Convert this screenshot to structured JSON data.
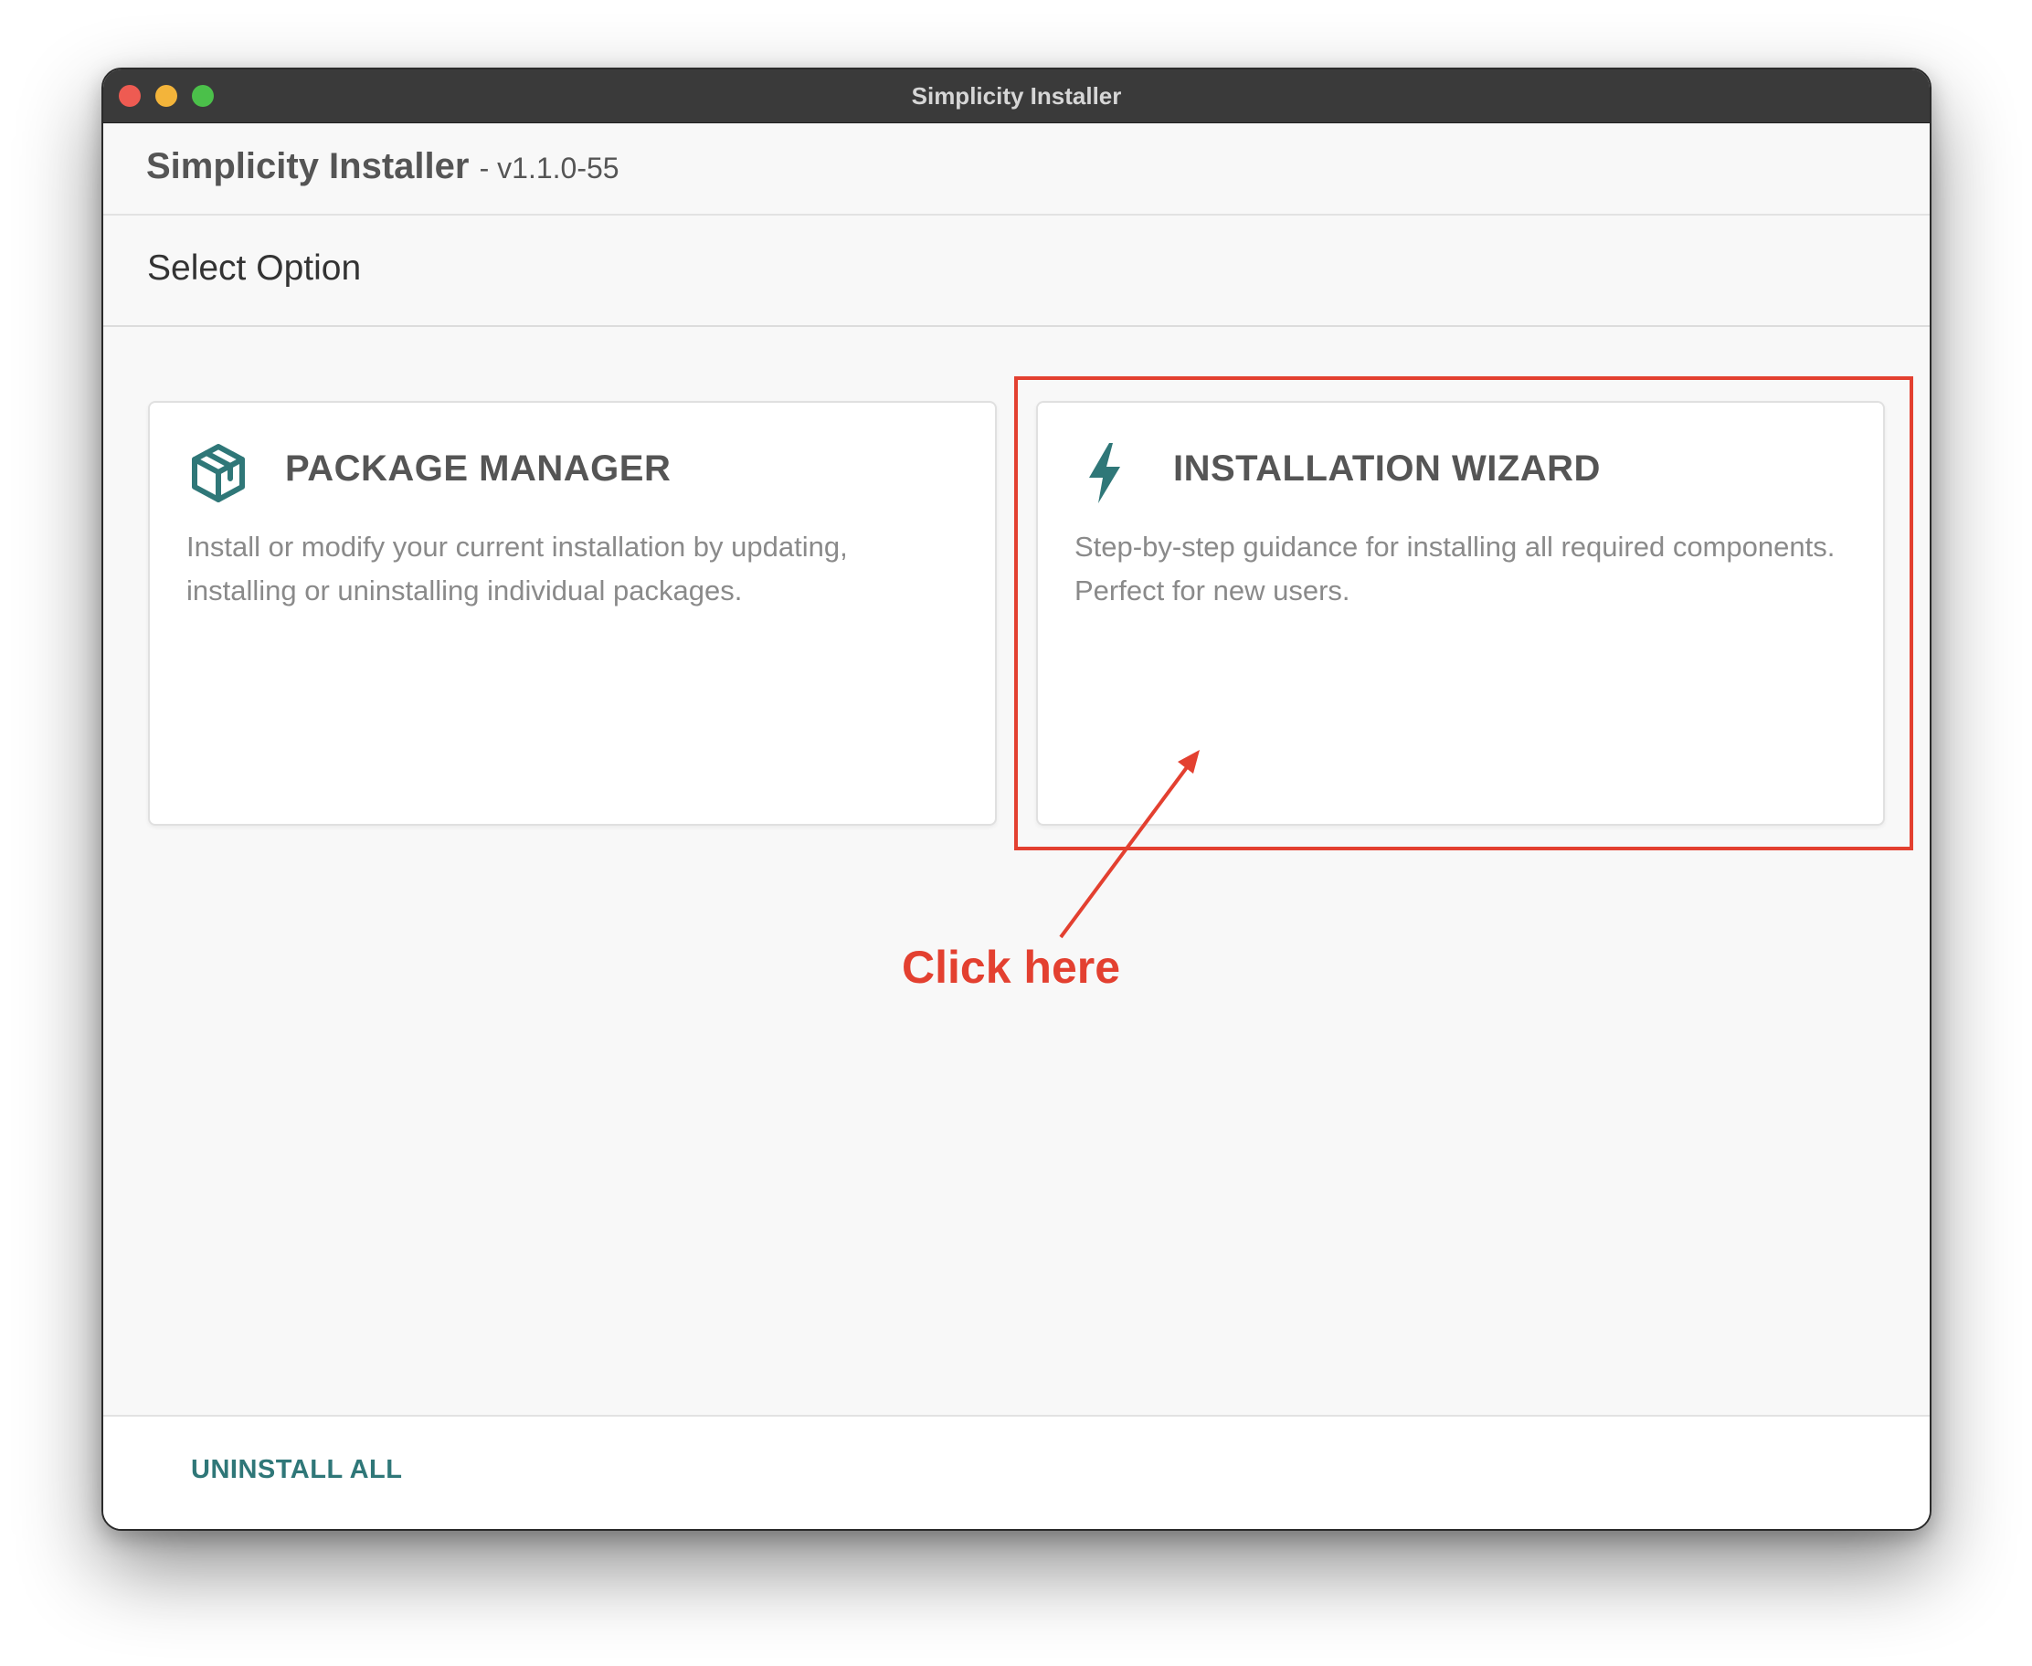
{
  "window": {
    "title": "Simplicity Installer"
  },
  "header": {
    "app_name": "Simplicity Installer",
    "version": "- v1.1.0-55"
  },
  "section": {
    "title": "Select Option"
  },
  "options": [
    {
      "title": "PACKAGE MANAGER",
      "description": "Install or modify your current installation by updating, installing or uninstalling individual packages.",
      "icon": "package-box-icon"
    },
    {
      "title": "INSTALLATION WIZARD",
      "description": "Step-by-step guidance for installing all required components. Perfect for new users.",
      "icon": "lightning-bolt-icon"
    }
  ],
  "annotation": {
    "text": "Click here",
    "color": "#e34030"
  },
  "footer": {
    "uninstall_label": "UNINSTALL ALL"
  },
  "colors": {
    "accent": "#2f7778",
    "titlebar": "#3a3a3a",
    "close": "#ee5b52",
    "minimize": "#f3b43a",
    "maximize": "#4bc04a"
  }
}
